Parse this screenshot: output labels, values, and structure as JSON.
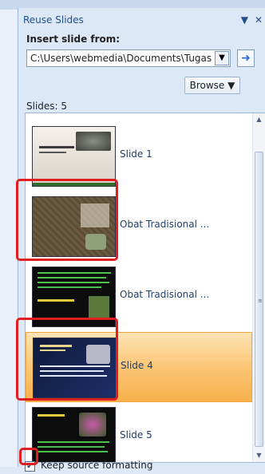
{
  "pane": {
    "title": "Reuse Slides",
    "insert_label": "Insert slide from:",
    "path_value": "C:\\Users\\webmedia\\Documents\\Tugas Mi",
    "browse_label": "Browse ▼",
    "slides_count": "Slides: 5",
    "keep_formatting_label": "Keep source formatting"
  },
  "slides": [
    {
      "label": "Slide 1"
    },
    {
      "label": "Obat Tradisional ..."
    },
    {
      "label": "Obat Tradisional ..."
    },
    {
      "label": "Slide 4"
    },
    {
      "label": "Slide 5"
    }
  ],
  "icons": [
    "dropdown-arrow-icon",
    "go-arrow-icon",
    "close-icon",
    "pane-menu-icon",
    "checkbox-checked-icon"
  ],
  "colors": {
    "accent": "#1f4e8c",
    "selection": "#fbc676",
    "annotation": "#e02020"
  }
}
